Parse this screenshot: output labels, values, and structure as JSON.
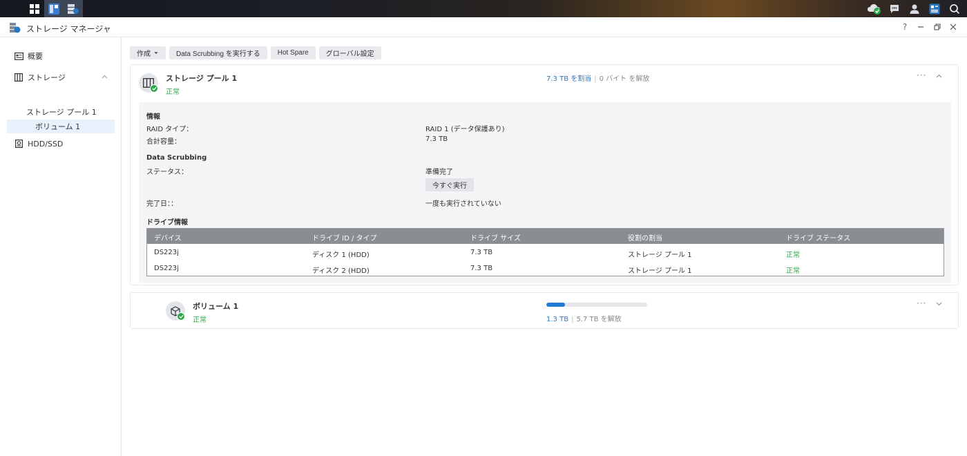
{
  "window": {
    "title": "ストレージ マネージャ"
  },
  "sidebar": {
    "items": [
      {
        "label": "概要"
      },
      {
        "label": "ストレージ"
      },
      {
        "label": "HDD/SSD"
      }
    ],
    "sub_items": [
      {
        "label": "ストレージ プール 1"
      },
      {
        "label": "ボリューム 1"
      }
    ]
  },
  "toolbar": {
    "create_label": "作成",
    "scrubbing_label": "Data Scrubbing を実行する",
    "hotspare_label": "Hot Spare",
    "global_label": "グローバル設定"
  },
  "pool": {
    "name": "ストレージ プール 1",
    "status": "正常",
    "allocated": "7.3 TB を割当",
    "free": "0 バイト を解放",
    "info_heading": "情報",
    "raid_label": "RAID タイプ：",
    "raid_value": "RAID 1 (データ保護あり)",
    "capacity_label": "合計容量：",
    "capacity_value": "7.3 TB",
    "scrub_heading": "Data Scrubbing",
    "scrub_status_label": "ステータス：",
    "scrub_status_value": "準備完了",
    "run_now_label": "今すぐ実行",
    "completed_label": "完了日：：",
    "completed_value": "一度も実行されていない",
    "drive_heading": "ドライブ情報",
    "drive_columns": [
      "デバイス",
      "ドライブ ID / タイプ",
      "ドライブ サイズ",
      "役割の割当",
      "ドライブ ステータス"
    ],
    "drives": [
      {
        "device": "DS223j",
        "id": "ディスク 1 (HDD)",
        "size": "7.3 TB",
        "role": "ストレージ プール 1",
        "status": "正常"
      },
      {
        "device": "DS223j",
        "id": "ディスク 2 (HDD)",
        "size": "7.3 TB",
        "role": "ストレージ プール 1",
        "status": "正常"
      }
    ]
  },
  "volume": {
    "name": "ボリューム 1",
    "status": "正常",
    "used": "1.3 TB",
    "free": "5.7 TB を解放",
    "usage_fraction": 0.185
  },
  "colors": {
    "accent": "#2a78c5",
    "ok": "#2ba84a",
    "table_header": "#8a8d91"
  }
}
